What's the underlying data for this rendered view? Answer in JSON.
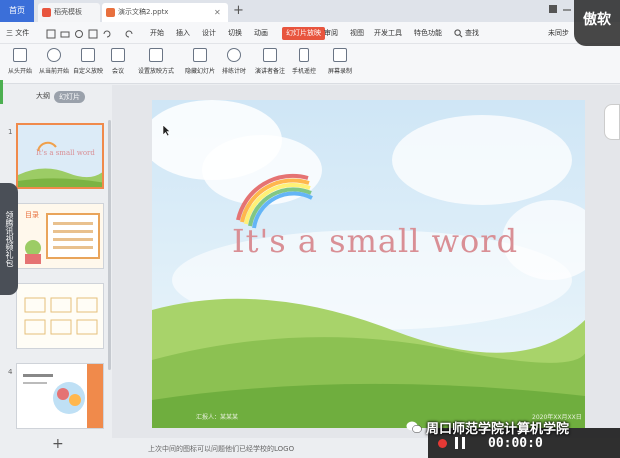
{
  "tabs": {
    "home": "首页",
    "doc1": "稻壳模板",
    "doc2": "演示文稿2.pptx"
  },
  "menu": {
    "file": "三 文件",
    "items": [
      "开始",
      "插入",
      "设计",
      "切换",
      "动画",
      "幻灯片放映",
      "审阅",
      "视图",
      "开发工具",
      "特色功能"
    ],
    "active_index": 5,
    "search": "查找",
    "collab": "未同步",
    "share": "协作"
  },
  "toolbar": {
    "items": [
      "从头开始",
      "从当前开始",
      "自定义放映",
      "会议",
      "设置放映方式",
      "隐藏幻灯片",
      "排练计时",
      "演讲者备注",
      "手机遥控",
      "屏幕录制"
    ]
  },
  "panel": {
    "tab_outline": "大纲",
    "tab_slides": "幻灯片",
    "slide_numbers": [
      "1",
      "2",
      "3",
      "4"
    ],
    "thumb1_title": "It's a small word",
    "thumb2_title": "目录",
    "add": "+"
  },
  "slide": {
    "title": "It's a small word",
    "bottom_left": "汇报人：某某某",
    "bottom_right": "2020年XX月XX日"
  },
  "notes": "上次中间的图标可以问题他们已经学校的LOGO",
  "side_strip": "领腾讯视频礼包",
  "logo": "傲软",
  "recorder": {
    "timer": "00:00:0"
  },
  "watermark": "周口师范学院计算机学院",
  "colors": {
    "accent": "#e8553e",
    "home_tab": "#3b6fd9",
    "title": "#d98f95"
  }
}
